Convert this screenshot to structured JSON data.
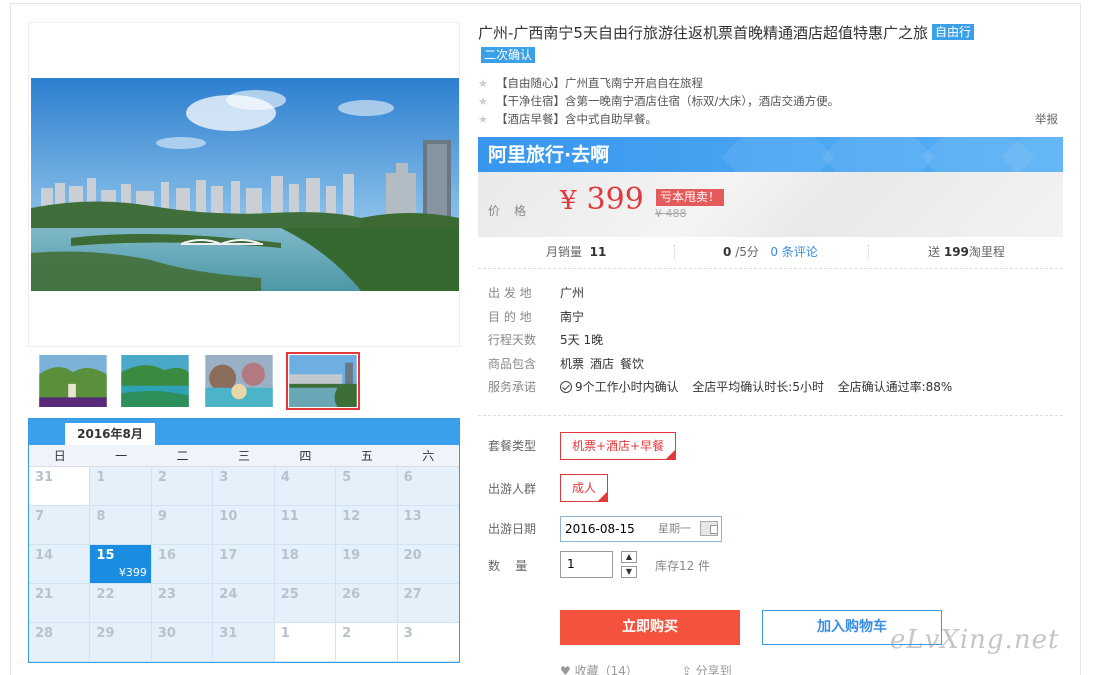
{
  "product": {
    "title": "广州-广西南宁5天自由行旅游往返机票首晚精通酒店超值特惠广之旅",
    "tag_free": "自由行",
    "tag_confirm": "二次确认",
    "features": [
      "【自由随心】广州直飞南宁开启自在旅程",
      "【干净住宿】含第一晚南宁酒店住宿（标双/大床），酒店交通方便。",
      "【酒店早餐】含中式自助早餐。"
    ],
    "report": "举报"
  },
  "promo": {
    "brand": "阿里旅行·去啊",
    "price_label": "价格",
    "currency": "¥",
    "price": "399",
    "badge": "亏本甩卖！",
    "old_price": "¥ 488"
  },
  "stats": {
    "monthly_sales_label": "月销量",
    "monthly_sales": "11",
    "rating": "0",
    "rating_suffix": "/5分",
    "reviews": "0 条评论",
    "points_prefix": "送",
    "points": "199",
    "points_suffix": "淘里程"
  },
  "info": {
    "departure_label": "出 发 地",
    "departure": "广州",
    "destination_label": "目 的 地",
    "destination": "南宁",
    "days_label": "行程天数",
    "days": "5天 1晚",
    "includes_label": "商品包含",
    "includes": [
      "机票",
      "酒店",
      "餐饮"
    ],
    "promise_label": "服务承诺",
    "promise_1": "9个工作小时内确认",
    "promise_2": "全店平均确认时长:5小时",
    "promise_3": "全店确认通过率:88%"
  },
  "options": {
    "package_label": "套餐类型",
    "package": "机票+酒店+早餐",
    "group_label": "出游人群",
    "group": "成人",
    "date_label": "出游日期",
    "date": "2016-08-15",
    "weekday": "星期一",
    "qty_label": "数    量",
    "qty": "1",
    "stock": "库存12 件"
  },
  "buttons": {
    "buy": "立即购买",
    "cart": "加入购物车",
    "favorite": "收藏（14）",
    "share": "分享到"
  },
  "calendar": {
    "month": "2016年8月",
    "weekdays": [
      "日",
      "一",
      "二",
      "三",
      "四",
      "五",
      "六"
    ],
    "days": [
      "31",
      "1",
      "2",
      "3",
      "4",
      "5",
      "6",
      "7",
      "8",
      "9",
      "10",
      "11",
      "12",
      "13",
      "14",
      "15",
      "16",
      "17",
      "18",
      "19",
      "20",
      "21",
      "22",
      "23",
      "24",
      "25",
      "26",
      "27",
      "28",
      "29",
      "30",
      "31",
      "1",
      "2",
      "3"
    ],
    "selected_price": "¥399"
  },
  "watermark": "eLvXing.net",
  "colors": {
    "accent_blue": "#3aa0ee",
    "price_red": "#e4393c",
    "buy_button": "#f5523d"
  }
}
